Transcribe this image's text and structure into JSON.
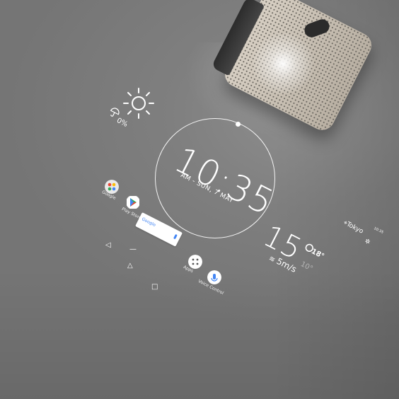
{
  "clock": {
    "time": "10:35",
    "date": "AM - SUN, 7 MAY"
  },
  "weather_summary": {
    "precip_chance": "0%",
    "icon": "sun-icon"
  },
  "apps": [
    {
      "label": "Google",
      "icon": "google-folder-icon"
    },
    {
      "label": "Play Store",
      "icon": "play-store-icon"
    },
    {
      "label": "Apps",
      "icon": "apps-grid-icon"
    },
    {
      "label": "Voice Control",
      "icon": "voice-control-icon"
    }
  ],
  "search": {
    "logo": "Google"
  },
  "nav": {
    "back": "◁",
    "home": "△",
    "recents": "□",
    "divider": "—"
  },
  "weather": {
    "temp": "15°",
    "high": "18°",
    "low": "10°",
    "wind": "5m/s",
    "location": "Tokyo",
    "status_time": "10:35"
  }
}
